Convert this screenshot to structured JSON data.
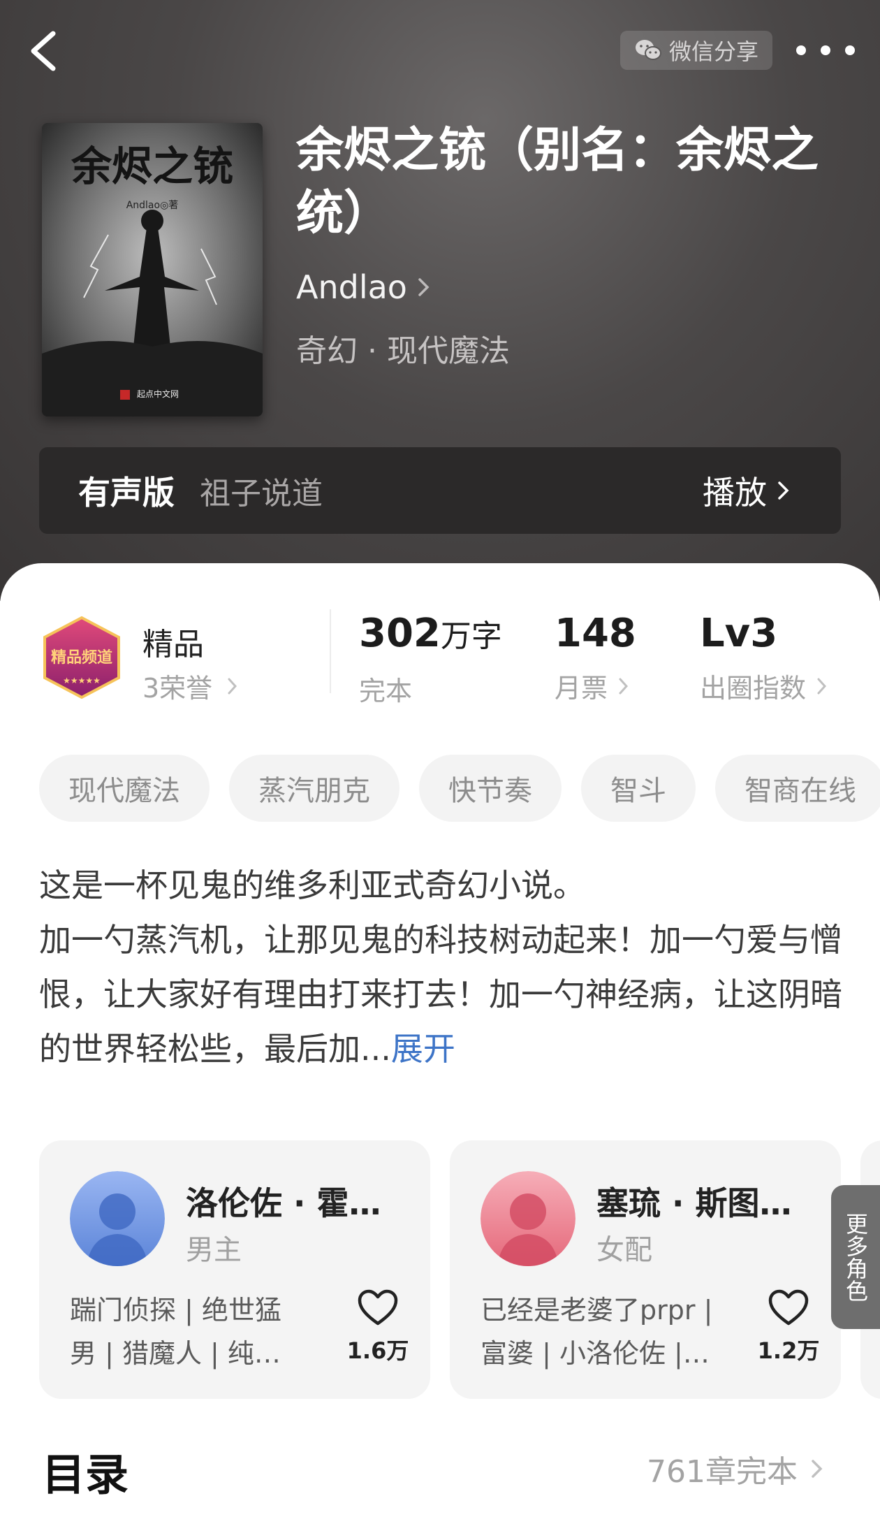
{
  "header": {
    "share_label": "微信分享"
  },
  "book": {
    "title": "余烬之铳（别名：余烬之统）",
    "author": "Andlao",
    "genre": "奇幻 · 现代魔法",
    "cover": {
      "title": "余烬之铳",
      "author": "Andlao◎著",
      "publisher": "起点中文网"
    }
  },
  "audio": {
    "label": "有声版",
    "narrator": "祖子说道",
    "play_label": "播放"
  },
  "honor": {
    "badge_text": "精品频道",
    "title": "精品",
    "sub": "3荣誉"
  },
  "stats": {
    "words_value": "302",
    "words_unit": "万字",
    "words_label": "完本",
    "tickets_value": "148",
    "tickets_label": "月票",
    "level_value": "Lv3",
    "level_label": "出圈指数"
  },
  "tags": [
    "现代魔法",
    "蒸汽朋克",
    "快节奏",
    "智斗",
    "智商在线"
  ],
  "synopsis": {
    "line1": "这是一杯见鬼的维多利亚式奇幻小说。",
    "line2": "加一勺蒸汽机，让那见鬼的科技树动起来！加一勺爱与憎恨，让大家好有理由打来打去！加一勺神经病，让这阴暗的世界轻松些，最后加...",
    "expand_label": "展开"
  },
  "roles": [
    {
      "name": "洛伦佐 · 霍…",
      "type": "男主",
      "desc": "踹门侦探 | 绝世猛男 | 猎魔人 | 纯…",
      "likes": "1.6万",
      "color": "#5b84d8"
    },
    {
      "name": "塞琉 · 斯图…",
      "type": "女配",
      "desc": "已经是老婆了prpr | 富婆 | 小洛伦佐 |…",
      "likes": "1.2万",
      "color": "#e5687a"
    }
  ],
  "more_roles_label": "更多角色",
  "toc": {
    "title": "目录",
    "count": "761章完本"
  }
}
